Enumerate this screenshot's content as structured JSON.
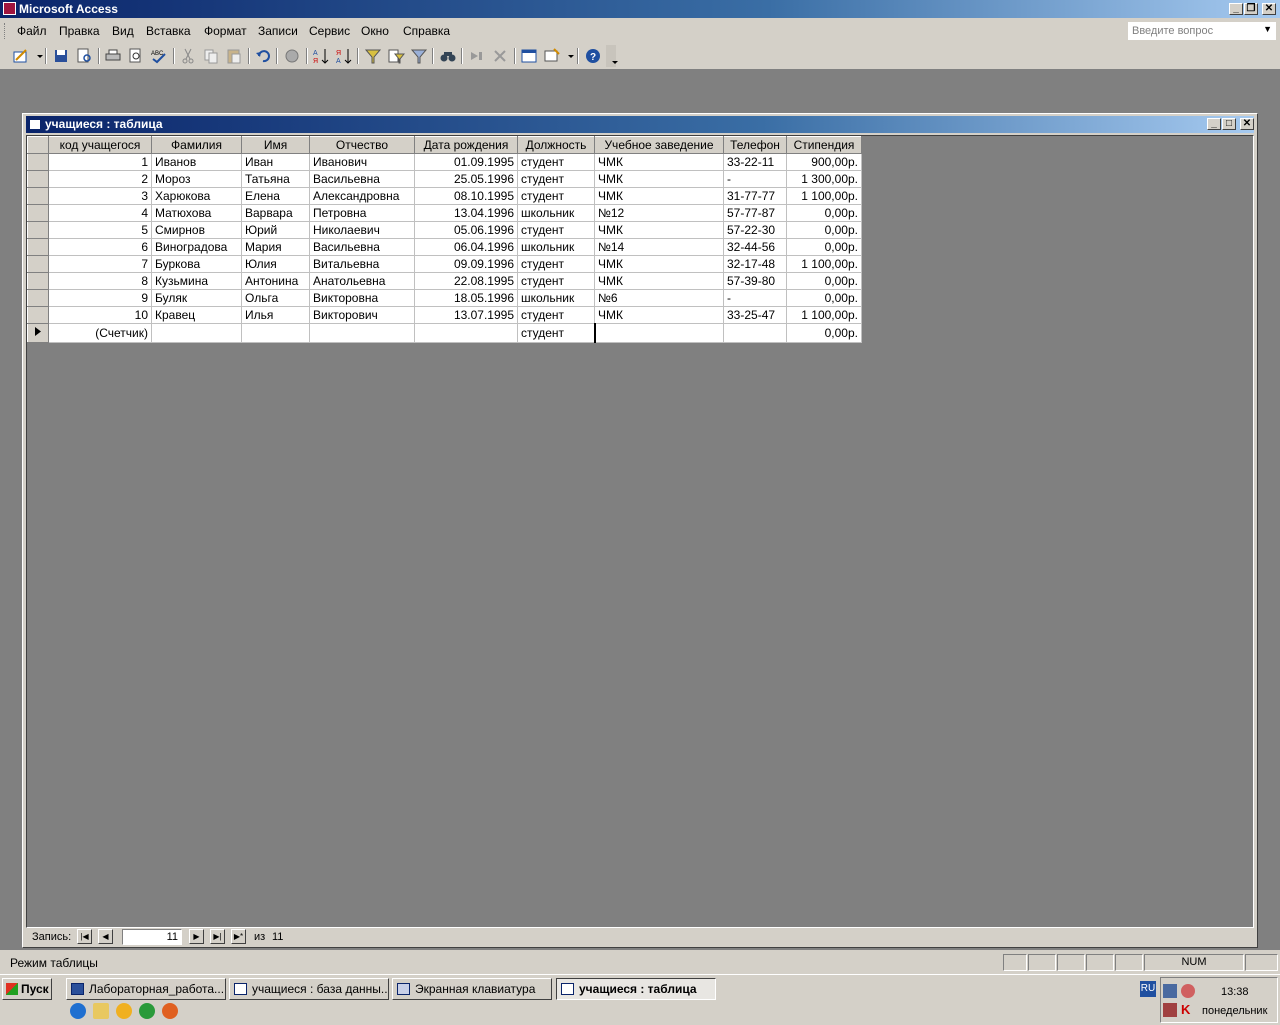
{
  "app": {
    "title": "Microsoft Access"
  },
  "menu": [
    "Файл",
    "Правка",
    "Вид",
    "Вставка",
    "Формат",
    "Записи",
    "Сервис",
    "Окно",
    "Справка"
  ],
  "question_box": {
    "placeholder": "Введите вопрос"
  },
  "table_window": {
    "title": "учащиеся : таблица",
    "columns": [
      "код учащегося",
      "Фамилия",
      "Имя",
      "Отчество",
      "Дата рождения",
      "Должность",
      "Учебное заведение",
      "Телефон",
      "Стипендия"
    ],
    "rows": [
      [
        "1",
        "Иванов",
        "Иван",
        "Иванович",
        "01.09.1995",
        "студент",
        "ЧМК",
        "33-22-11",
        "900,00р."
      ],
      [
        "2",
        "Мороз",
        "Татьяна",
        "Васильевна",
        "25.05.1996",
        "студент",
        "ЧМК",
        "-",
        "1 300,00р."
      ],
      [
        "3",
        "Харюкова",
        "Елена",
        "Александровна",
        "08.10.1995",
        "студент",
        "ЧМК",
        "31-77-77",
        "1 100,00р."
      ],
      [
        "4",
        "Матюхова",
        "Варвара",
        "Петровна",
        "13.04.1996",
        "школьник",
        "№12",
        "57-77-87",
        "0,00р."
      ],
      [
        "5",
        "Смирнов",
        "Юрий",
        "Николаевич",
        "05.06.1996",
        "студент",
        "ЧМК",
        "57-22-30",
        "0,00р."
      ],
      [
        "6",
        "Виноградова",
        "Мария",
        "Васильевна",
        "06.04.1996",
        "школьник",
        "№14",
        "32-44-56",
        "0,00р."
      ],
      [
        "7",
        "Буркова",
        "Юлия",
        "Витальевна",
        "09.09.1996",
        "студент",
        "ЧМК",
        "32-17-48",
        "1 100,00р."
      ],
      [
        "8",
        "Кузьмина",
        "Антонина",
        "Анатольевна",
        "22.08.1995",
        "студент",
        "ЧМК",
        "57-39-80",
        "0,00р."
      ],
      [
        "9",
        "Буляк",
        "Ольга",
        "Викторовна",
        "18.05.1996",
        "школьник",
        "№6",
        "-",
        "0,00р."
      ],
      [
        "10",
        "Кравец",
        "Илья",
        "Викторович",
        "13.07.1995",
        "студент",
        "ЧМК",
        "33-25-47",
        "1 100,00р."
      ]
    ],
    "new_row": [
      "(Счетчик)",
      "",
      "",
      "",
      "",
      "студент",
      "",
      "",
      "0,00р."
    ],
    "navigator": {
      "label": "Запись:",
      "current": "11",
      "of_label": "из",
      "total": "11"
    }
  },
  "status": {
    "text": "Режим таблицы",
    "num": "NUM"
  },
  "taskbar": {
    "start": "Пуск",
    "tasks": [
      "Лабораторная_работа...",
      "учащиеся : база данны...",
      "Экранная клавиатура",
      "учащиеся : таблица"
    ],
    "lang": "RU",
    "time": "13:38",
    "day": "понедельник"
  }
}
